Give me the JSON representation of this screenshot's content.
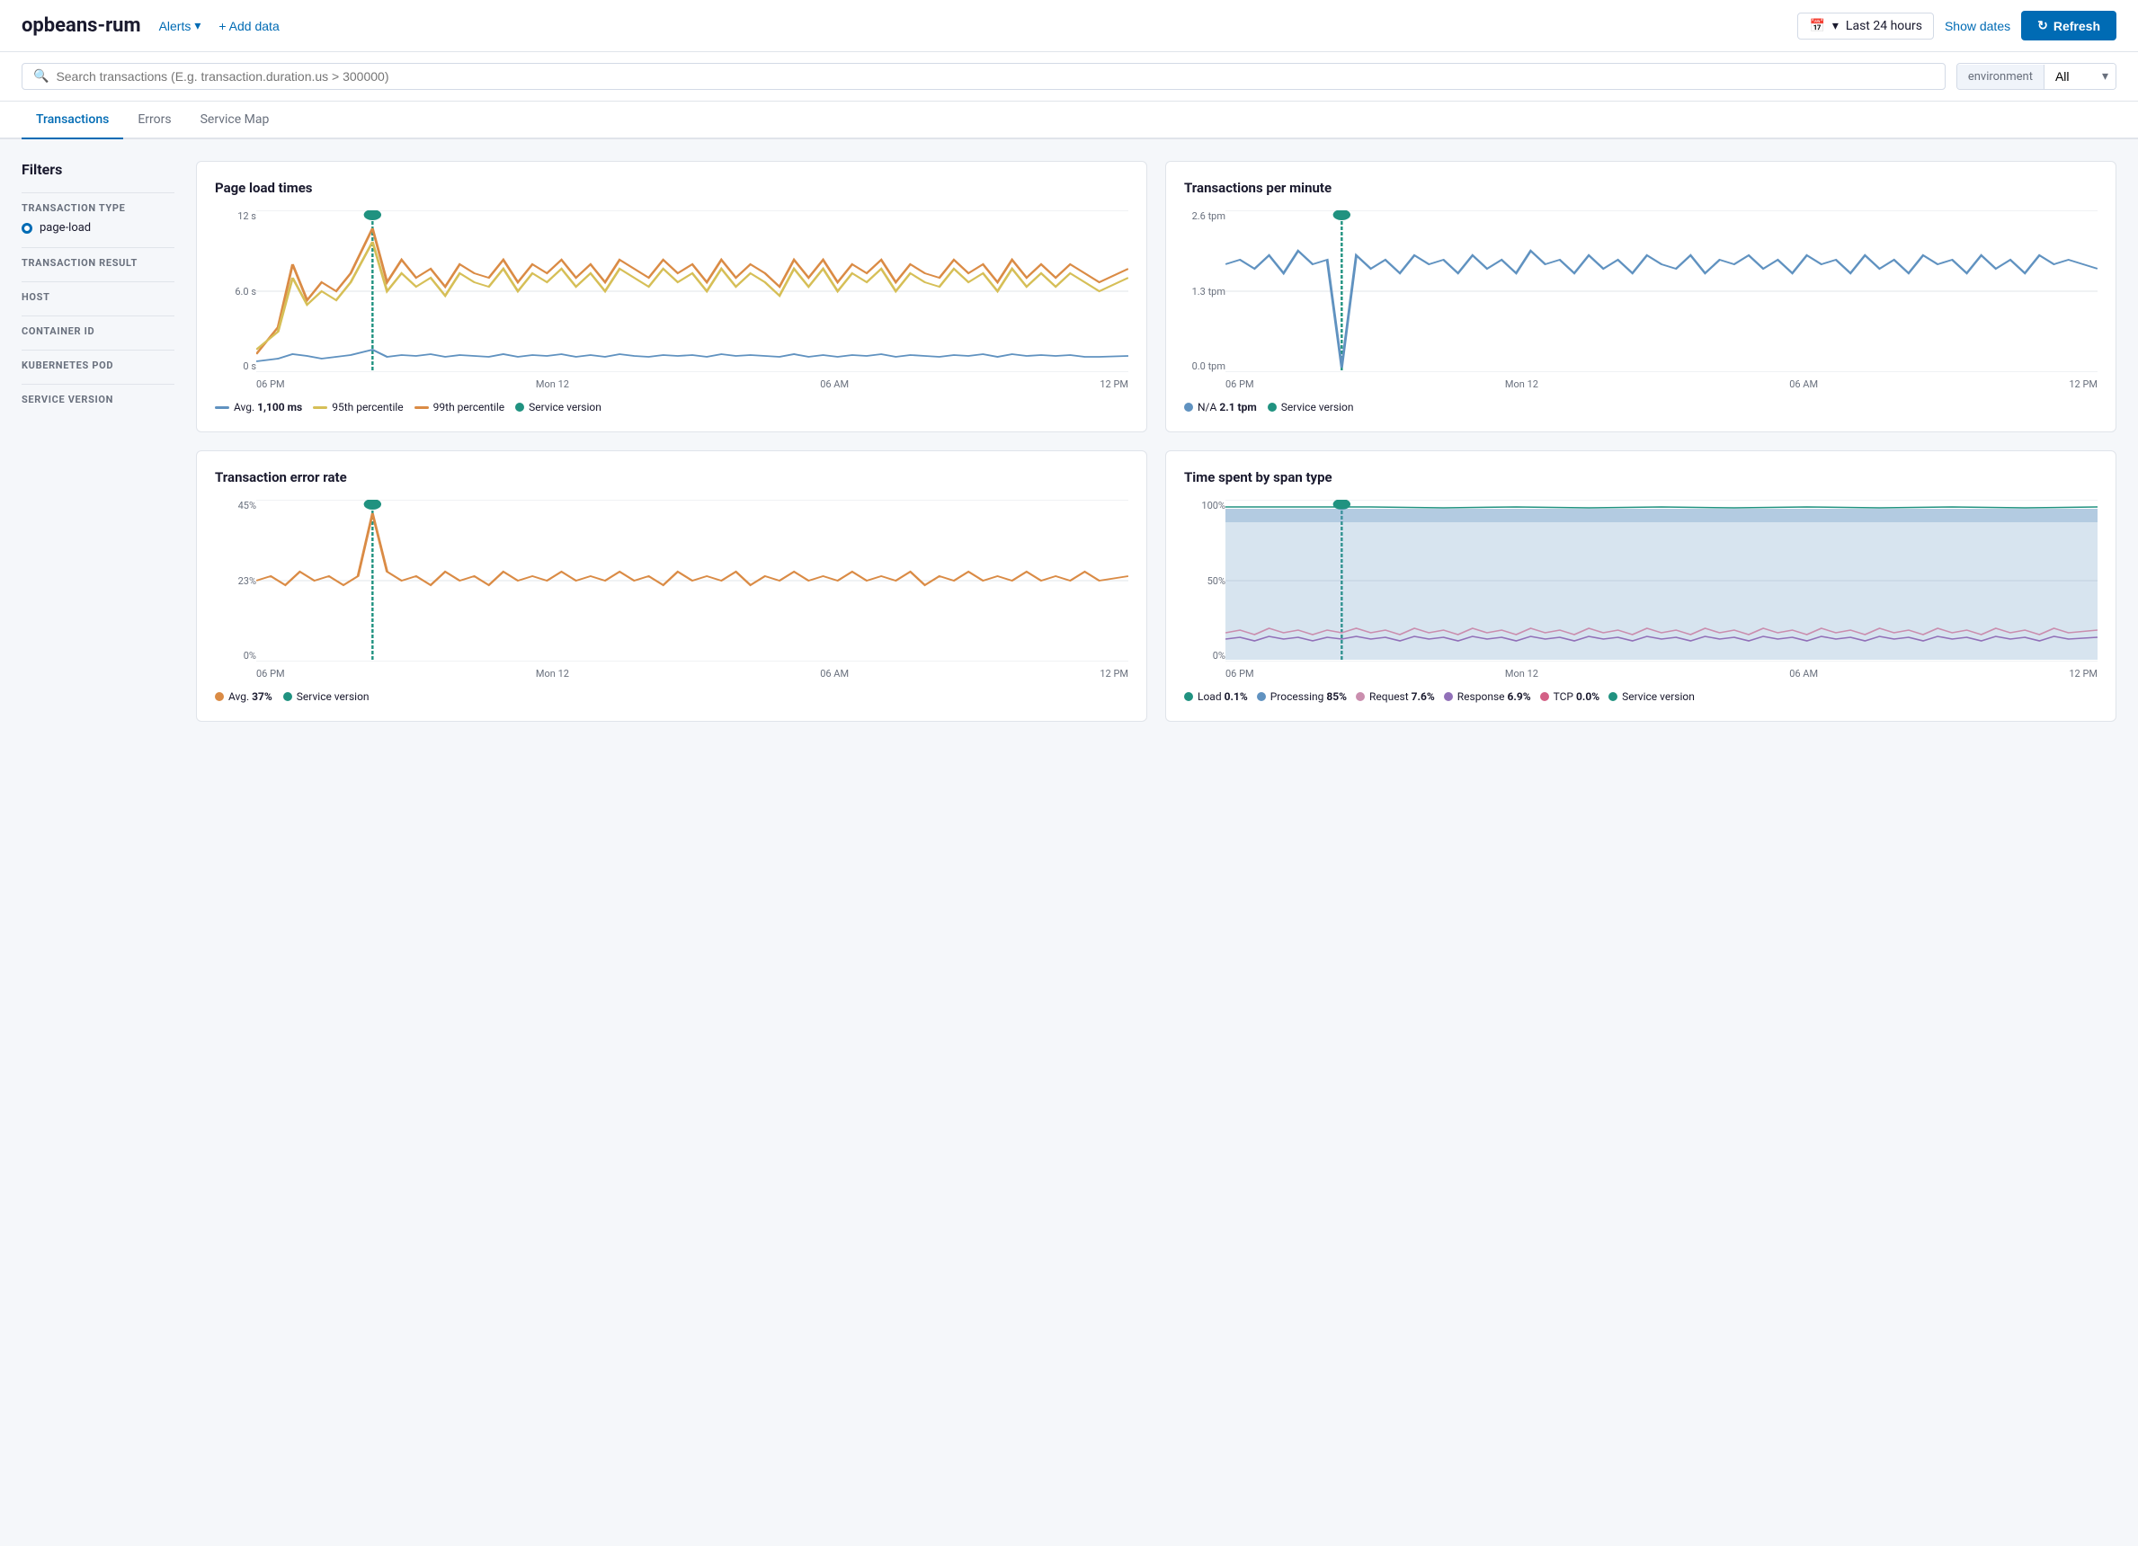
{
  "header": {
    "app_title": "opbeans-rum",
    "alerts_label": "Alerts",
    "add_data_label": "+ Add data",
    "time_range": "Last 24 hours",
    "show_dates_label": "Show dates",
    "refresh_label": "Refresh"
  },
  "search": {
    "placeholder": "Search transactions (E.g. transaction.duration.us > 300000)",
    "env_label": "environment",
    "env_value": "All"
  },
  "tabs": [
    {
      "label": "Transactions",
      "active": true
    },
    {
      "label": "Errors",
      "active": false
    },
    {
      "label": "Service Map",
      "active": false
    }
  ],
  "sidebar": {
    "title": "Filters",
    "sections": [
      {
        "label": "TRANSACTION TYPE",
        "items": [
          {
            "text": "page-load",
            "selected": true
          }
        ]
      },
      {
        "label": "TRANSACTION RESULT",
        "items": []
      },
      {
        "label": "HOST",
        "items": []
      },
      {
        "label": "CONTAINER ID",
        "items": []
      },
      {
        "label": "KUBERNETES POD",
        "items": []
      },
      {
        "label": "SERVICE VERSION",
        "items": []
      }
    ]
  },
  "charts": {
    "page_load_times": {
      "title": "Page load times",
      "y_labels": [
        "12 s",
        "6.0 s",
        "0 s"
      ],
      "x_labels": [
        "06 PM",
        "Mon 12",
        "06 AM",
        "12 PM"
      ],
      "legend": [
        {
          "label": "Avg. 1,100 ms",
          "color": "#6092C0",
          "type": "line"
        },
        {
          "label": "95th percentile",
          "color": "#D6BF57",
          "type": "line"
        },
        {
          "label": "99th percentile",
          "color": "#DA8B45",
          "type": "line"
        },
        {
          "label": "Service version",
          "color": "#209280",
          "type": "dot"
        }
      ]
    },
    "transactions_per_minute": {
      "title": "Transactions per minute",
      "y_labels": [
        "2.6 tpm",
        "1.3 tpm",
        "0.0 tpm"
      ],
      "x_labels": [
        "06 PM",
        "Mon 12",
        "06 AM",
        "12 PM"
      ],
      "legend": [
        {
          "label": "N/A",
          "color": "#6092C0",
          "type": "dot"
        },
        {
          "label": "2.1 tpm",
          "color": null,
          "type": "text_bold"
        },
        {
          "label": "Service version",
          "color": "#209280",
          "type": "dot"
        }
      ]
    },
    "transaction_error_rate": {
      "title": "Transaction error rate",
      "y_labels": [
        "45%",
        "23%",
        "0%"
      ],
      "x_labels": [
        "06 PM",
        "Mon 12",
        "06 AM",
        "12 PM"
      ],
      "legend": [
        {
          "label": "Avg. 37%",
          "color": "#DA8B45",
          "type": "dot"
        },
        {
          "label": "Service version",
          "color": "#209280",
          "type": "dot"
        }
      ]
    },
    "time_spent_by_span": {
      "title": "Time spent by span type",
      "y_labels": [
        "100%",
        "50%",
        "0%"
      ],
      "x_labels": [
        "06 PM",
        "Mon 12",
        "06 AM",
        "12 PM"
      ],
      "legend": [
        {
          "label": "Load 0.1%",
          "color": "#209280",
          "type": "dot"
        },
        {
          "label": "Processing 85%",
          "color": "#6092C0",
          "type": "dot"
        },
        {
          "label": "Request 7.6%",
          "color": "#CA8EAE",
          "type": "dot"
        },
        {
          "label": "Response 6.9%",
          "color": "#9170B8",
          "type": "dot"
        },
        {
          "label": "TCP 0.0%",
          "color": "#D36086",
          "type": "dot"
        },
        {
          "label": "Service version",
          "color": "#209280",
          "type": "dot"
        }
      ]
    }
  }
}
